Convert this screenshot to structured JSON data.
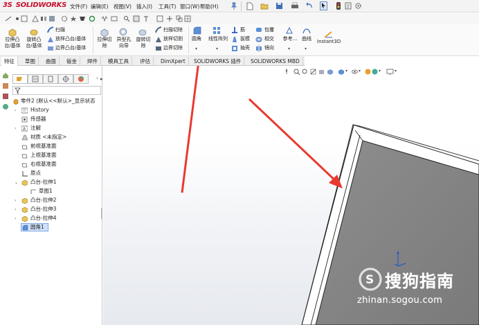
{
  "app": {
    "brand": "SOLIDWORKS",
    "brand_prefix": "3S"
  },
  "menu": [
    "文件(F)",
    "编辑(E)",
    "视图(V)",
    "插入(I)",
    "工具(T)",
    "窗口(W)",
    "帮助(H)"
  ],
  "ribbon": {
    "extrude_boss": "拉伸凸\n台/基体",
    "revolve_boss": "旋转凸\n台/基体",
    "sweep": "扫描",
    "loft": "放样凸台/基体",
    "boundary_boss": "边界凸台/基体",
    "extrude_cut": "拉伸切\n除",
    "hole_wizard": "异型孔\n向导",
    "revolve_cut": "旋转切\n除",
    "swept_cut": "扫描切除",
    "lofted_cut": "放样切割",
    "boundary_cut": "边界切除",
    "fillet": "圆角",
    "linear_pattern": "线性阵列",
    "rib": "筋",
    "draft": "拔模",
    "shell": "抽壳",
    "wrap": "包覆",
    "intersect": "相交",
    "mirror": "镜向",
    "reference": "参考...",
    "curves": "曲线",
    "instant3d": "Instant3D"
  },
  "tabs": [
    "特征",
    "草图",
    "曲面",
    "钣金",
    "焊件",
    "模具工具",
    "评估",
    "DimXpert",
    "SOLIDWORKS 插件",
    "SOLIDWORKS MBD"
  ],
  "tree": {
    "root": "零件2  (默认<<默认>_显示状态",
    "items": [
      "History",
      "传感器",
      "注解",
      "材质 <未指定>",
      "前视基准面",
      "上视基准面",
      "右视基准面",
      "原点",
      "凸台-拉伸1",
      "草图1",
      "凸台-拉伸2",
      "凸台-拉伸3",
      "凸台-拉伸4",
      "圆角1"
    ]
  },
  "watermark": {
    "brand": "搜狗指南",
    "url": "zhinan.sogou.com"
  },
  "colors": {
    "accent_red": "#e8392f",
    "panel_blue": "#d9e8fb",
    "part_gray": "#8a8a8a"
  }
}
